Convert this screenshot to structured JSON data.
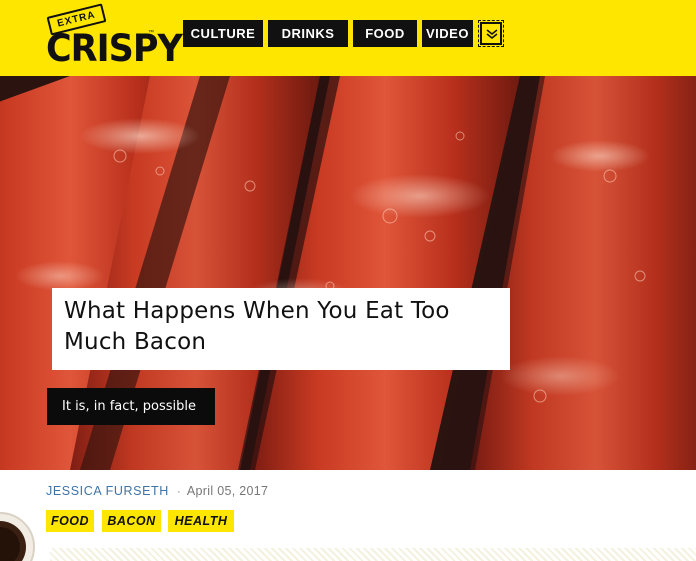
{
  "header": {
    "logo_extra": "EXTRA",
    "logo_crispy": "CRISPY",
    "logo_tm": "™",
    "nav": [
      {
        "label": "CULTURE"
      },
      {
        "label": "DRINKS"
      },
      {
        "label": "FOOD"
      },
      {
        "label": "VIDEO"
      }
    ],
    "more_icon": "chevron-down-double-icon"
  },
  "hero": {
    "image_subject": "bacon",
    "headline": "What Happens When You Eat Too Much Bacon",
    "dek": "It is, in fact, possible"
  },
  "meta": {
    "author": "JESSICA FURSETH",
    "separator": "·",
    "date": "April 05, 2017"
  },
  "tags": [
    {
      "label": "FOOD"
    },
    {
      "label": "BACON"
    },
    {
      "label": "HEALTH"
    }
  ],
  "colors": {
    "brand_yellow": "#ffe600",
    "nav_black": "#111111",
    "author_blue": "#3d74a8"
  }
}
